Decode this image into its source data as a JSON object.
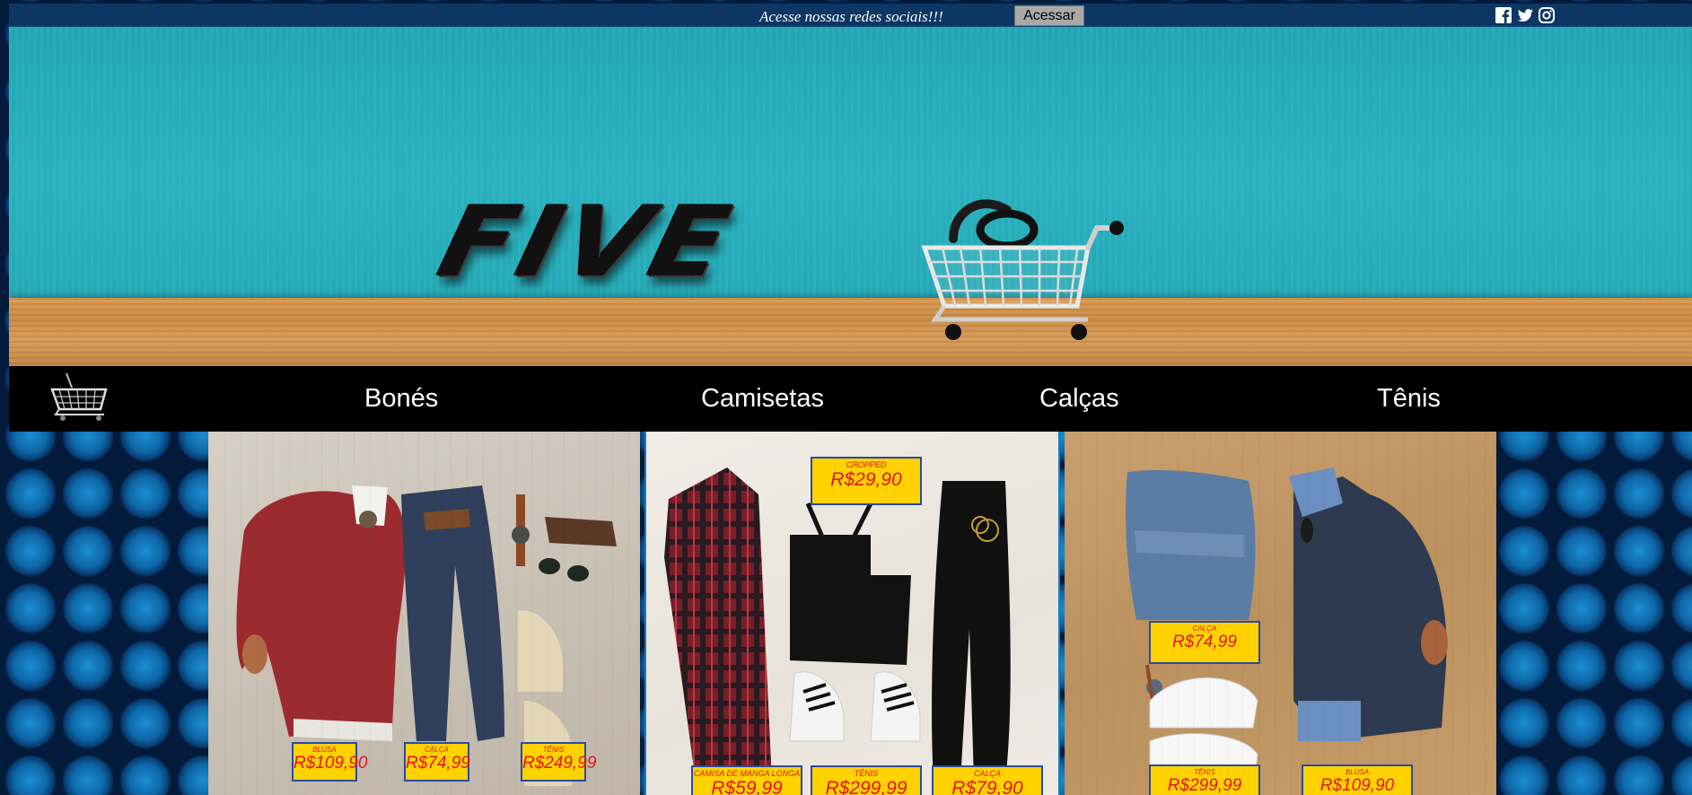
{
  "topbar": {
    "tagline": "Acesse nossas redes sociais!!!",
    "access_button": "Acessar",
    "social_icons": [
      "facebook-icon",
      "twitter-icon",
      "instagram-icon"
    ]
  },
  "banner": {
    "logo_text": "FIVE"
  },
  "nav": {
    "items": [
      "Bonés",
      "Camisetas",
      "Calças",
      "Tênis"
    ]
  },
  "products": {
    "look1": {
      "tags": [
        {
          "label": "BLUSA",
          "price": "R$109,90"
        },
        {
          "label": "CALÇA",
          "price": "R$74,99"
        },
        {
          "label": "TÊNIS",
          "price": "R$249,99"
        }
      ]
    },
    "look2": {
      "tags": [
        {
          "label": "CROPPED",
          "price": "R$29,90"
        },
        {
          "label": "CAMISA DE MANGA LONGA",
          "price": "R$59,99"
        },
        {
          "label": "TÊNIS",
          "price": "R$299,99"
        },
        {
          "label": "CALÇA",
          "price": "R$79,90"
        }
      ]
    },
    "look3": {
      "tags": [
        {
          "label": "CALÇA",
          "price": "R$74,99"
        },
        {
          "label": "TÊNIS",
          "price": "R$299,99"
        },
        {
          "label": "BLUSA",
          "price": "R$109,90"
        }
      ]
    }
  },
  "colors": {
    "topbar": "#0d3763",
    "navbar": "#000000",
    "price_tag_bg": "#ffd200",
    "price_tag_text": "#e2161b",
    "price_tag_border": "#2b4aa2"
  }
}
